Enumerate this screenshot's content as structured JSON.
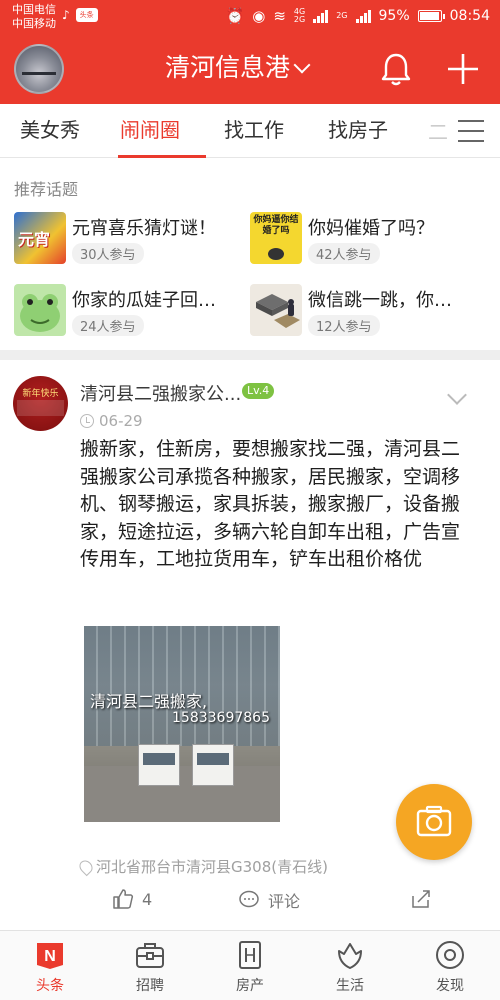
{
  "status_bar": {
    "carrier_1": "中国电信",
    "carrier_2": "中国移动",
    "app_badge": "头条",
    "network_label_top": "4G",
    "network_label_bottom": "2G",
    "network_label_2": "2G",
    "battery": "95%",
    "battery_level": 0.95,
    "time": "08:54"
  },
  "header": {
    "title": "清河信息港",
    "icons": [
      "avatar",
      "chevron-down-icon",
      "bell-icon",
      "plus-icon"
    ]
  },
  "tabs": {
    "items": [
      "美女秀",
      "闹闹圈",
      "找工作",
      "找房子"
    ],
    "active": "闹闹圈",
    "more_partial": "二"
  },
  "topics": {
    "label": "推荐话题",
    "items": [
      {
        "name": "元宵喜乐猜灯谜！",
        "count": "30人参与",
        "thumb_text": "元宵"
      },
      {
        "name": "你妈催婚了吗？",
        "count": "42人参与",
        "thumb_text": "你妈逼你结婚了吗"
      },
      {
        "name": "你家的瓜娃子回…",
        "count": "24人参与",
        "thumb_text": ""
      },
      {
        "name": "微信跳一跳，你…",
        "count": "12人参与",
        "thumb_text": ""
      }
    ]
  },
  "post": {
    "avatar_text": "新年快乐",
    "author": "清河县二强搬家公...",
    "level": "Lv.4",
    "date": "06-29",
    "body": "搬新家，住新房，要想搬家找二强，清河县二强搬家公司承揽各种搬家，居民搬家，空调移机、钢琴搬运，家具拆装，搬家搬厂，设备搬家，短途拉运，多辆六轮自卸车出租，广告宣传用车，工地拉货用车，铲车出租价格优",
    "image_caption_1": "清河县二强搬家,",
    "image_caption_2": "15833697865",
    "location": "河北省邢台市清河县G308(青石线)",
    "likes": "4",
    "comment_label": "评论"
  },
  "bottom_nav": {
    "items": [
      {
        "label": "头条",
        "icon": "news-icon",
        "active": true
      },
      {
        "label": "招聘",
        "icon": "briefcase-icon",
        "active": false
      },
      {
        "label": "房产",
        "icon": "building-icon",
        "active": false
      },
      {
        "label": "生活",
        "icon": "flower-icon",
        "active": false
      },
      {
        "label": "发现",
        "icon": "eye-icon",
        "active": false
      }
    ]
  },
  "colors": {
    "brand": "#ea3a2d",
    "fab": "#f5a623",
    "level_badge": "#7ec242"
  }
}
